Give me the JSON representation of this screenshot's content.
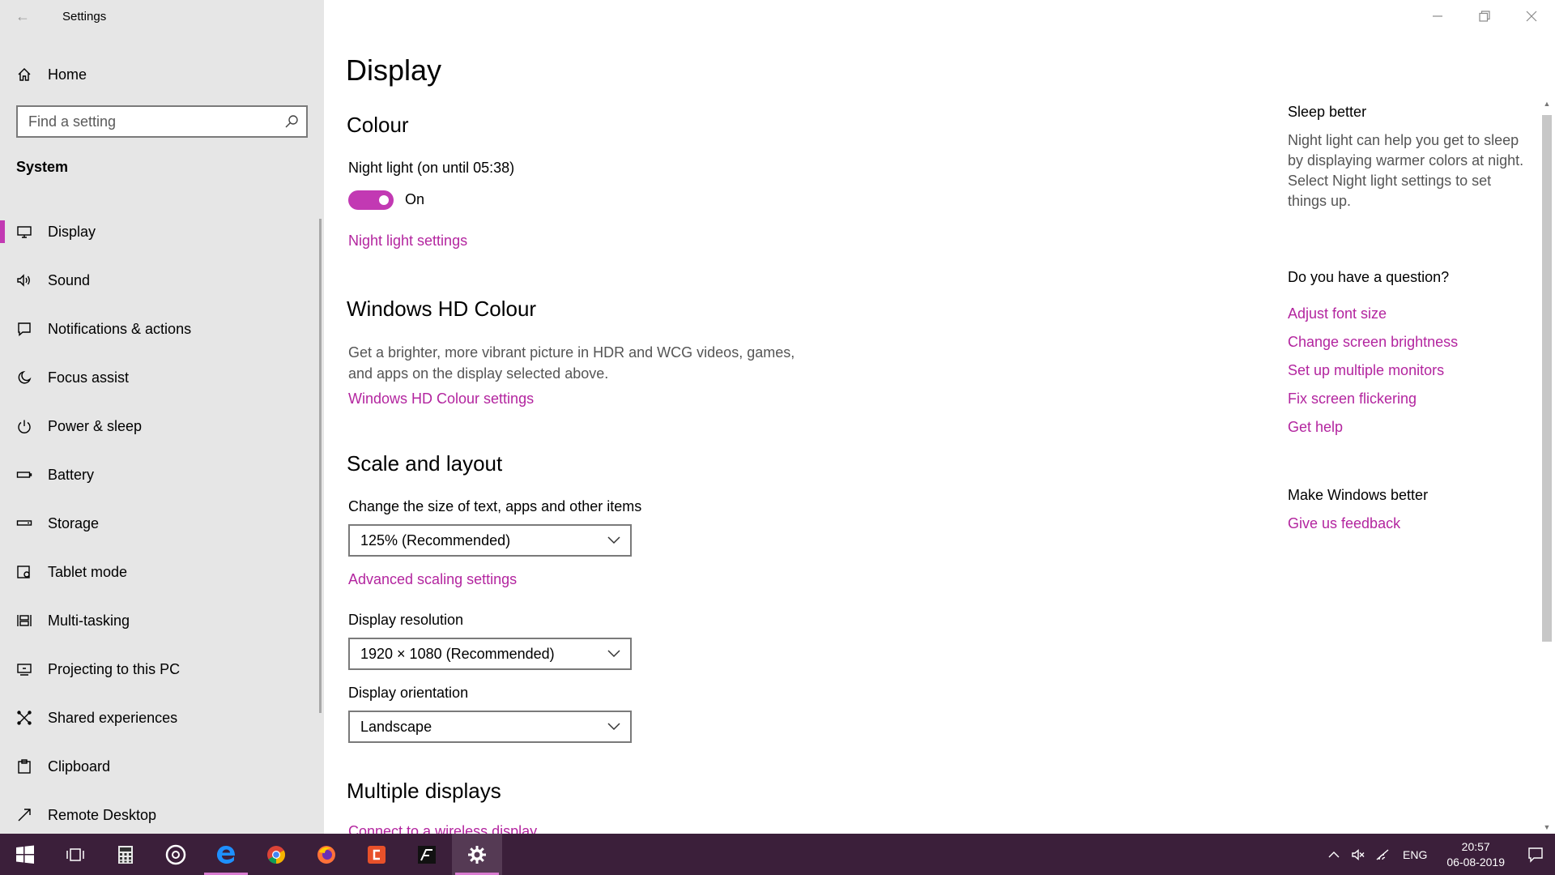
{
  "window": {
    "title": "Settings",
    "controls": [
      "minimize",
      "restore",
      "close"
    ]
  },
  "sidebar": {
    "home_label": "Home",
    "search_placeholder": "Find a setting",
    "section": "System",
    "items": [
      {
        "label": "Display",
        "icon": "monitor-icon",
        "active": true
      },
      {
        "label": "Sound",
        "icon": "speaker-icon"
      },
      {
        "label": "Notifications & actions",
        "icon": "notification-icon"
      },
      {
        "label": "Focus assist",
        "icon": "moon-icon"
      },
      {
        "label": "Power & sleep",
        "icon": "power-icon"
      },
      {
        "label": "Battery",
        "icon": "battery-icon"
      },
      {
        "label": "Storage",
        "icon": "storage-icon"
      },
      {
        "label": "Tablet mode",
        "icon": "tablet-icon"
      },
      {
        "label": "Multi-tasking",
        "icon": "multitasking-icon"
      },
      {
        "label": "Projecting to this PC",
        "icon": "projecting-icon"
      },
      {
        "label": "Shared experiences",
        "icon": "shared-icon"
      },
      {
        "label": "Clipboard",
        "icon": "clipboard-icon"
      },
      {
        "label": "Remote Desktop",
        "icon": "remote-desktop-icon"
      }
    ]
  },
  "main": {
    "page_title": "Display",
    "colour": {
      "heading": "Colour",
      "night_light_label": "Night light (on until 05:38)",
      "toggle_state": "On",
      "night_light_settings": "Night light settings"
    },
    "hdr": {
      "heading": "Windows HD Colour",
      "description": "Get a brighter, more vibrant picture in HDR and WCG videos, games, and apps on the display selected above.",
      "settings_link": "Windows HD Colour settings"
    },
    "scale": {
      "heading": "Scale and layout",
      "size_label": "Change the size of text, apps and other items",
      "size_value": "125% (Recommended)",
      "advanced_link": "Advanced scaling settings",
      "resolution_label": "Display resolution",
      "resolution_value": "1920 × 1080 (Recommended)",
      "orientation_label": "Display orientation",
      "orientation_value": "Landscape"
    },
    "multiple": {
      "heading": "Multiple displays",
      "connect_link": "Connect to a wireless display"
    }
  },
  "right_panel": {
    "sleep_heading": "Sleep better",
    "sleep_text": "Night light can help you get to sleep by displaying warmer colors at night. Select Night light settings to set things up.",
    "question_heading": "Do you have a question?",
    "question_links": [
      "Adjust font size",
      "Change screen brightness",
      "Set up multiple monitors",
      "Fix screen flickering",
      "Get help"
    ],
    "feedback_heading": "Make Windows better",
    "feedback_link": "Give us feedback"
  },
  "taskbar": {
    "apps": [
      "start-icon",
      "task-view-icon",
      "calculator-icon",
      "groove-icon",
      "edge-icon",
      "chrome-icon",
      "firefox-icon",
      "app-c-icon",
      "app-f-icon",
      "settings-icon"
    ],
    "language": "ENG",
    "time": "20:57",
    "date": "06-08-2019"
  },
  "colors": {
    "accent": "#c239b3",
    "link": "#b3259f",
    "taskbar": "#3b1f3a",
    "sidebar": "#e6e6e6"
  }
}
